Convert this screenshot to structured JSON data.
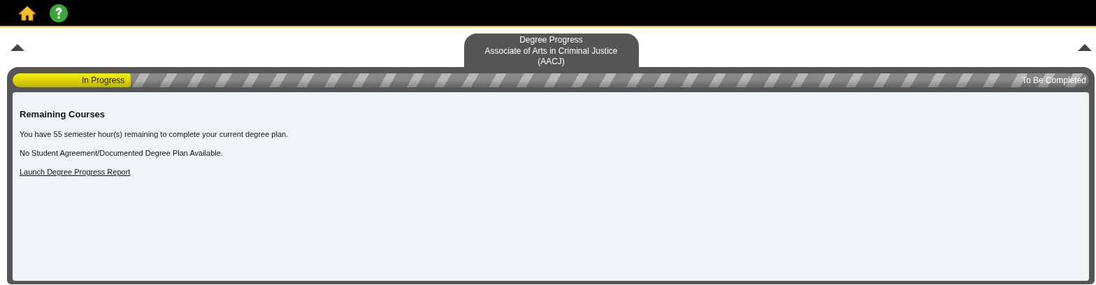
{
  "tab": {
    "lines": [
      "Degree Progress",
      "Associate of Arts in Criminal Justice",
      "(AACJ)"
    ]
  },
  "progress": {
    "level": 0.11,
    "start_label": "In Progress",
    "end_label": "To Be Completed"
  },
  "content": {
    "heading": "Remaining Courses",
    "paragraphs": [
      "You have 55 semester hour(s) remaining to complete your current degree plan.",
      "No Student Agreement/Documented Degree Plan Available."
    ],
    "link": "Launch Degree Progress Report"
  }
}
